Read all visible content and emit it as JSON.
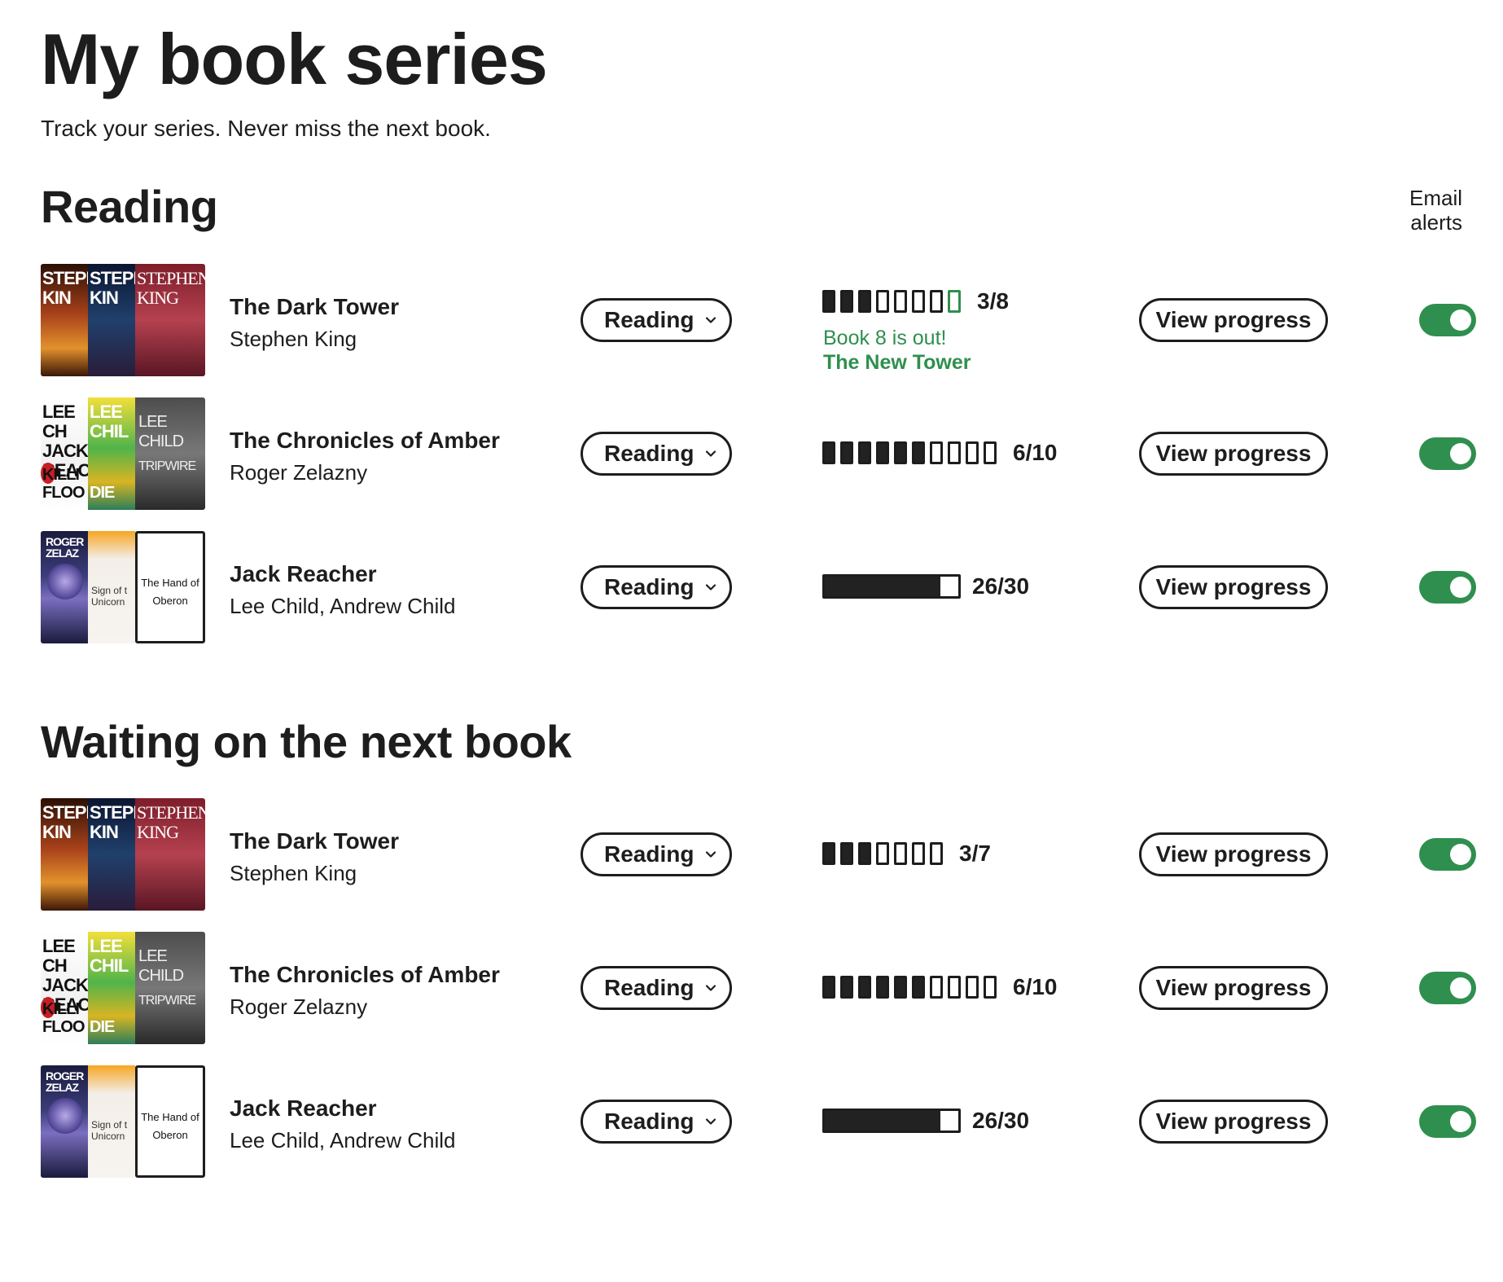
{
  "page": {
    "title": "My book series",
    "subtitle": "Track your series. Never miss the next book."
  },
  "colors": {
    "accent_green": "#2f8f4e",
    "text": "#1d1d1d"
  },
  "sections": [
    {
      "title": "Reading",
      "email_alerts_label": "Email alerts",
      "rows": [
        {
          "name": "The Dark Tower",
          "author": "Stephen King",
          "status": "Reading",
          "progress_text": "3/8",
          "progress_read": 3,
          "progress_total": 8,
          "progress_style": "segments",
          "new_book_segment": 8,
          "new_notice": "Book 8 is out!",
          "new_title": "The New Tower",
          "view_label": "View progress",
          "email_alerts": true,
          "covers": [
            "dark-tower",
            "dark-tower",
            "dark-tower"
          ]
        },
        {
          "name": "The Chronicles of Amber",
          "author": "Roger Zelazny",
          "status": "Reading",
          "progress_text": "6/10",
          "progress_read": 6,
          "progress_total": 10,
          "progress_style": "segments",
          "view_label": "View progress",
          "email_alerts": true,
          "covers": [
            "jack-reacher",
            "jack-reacher",
            "jack-reacher"
          ]
        },
        {
          "name": "Jack Reacher",
          "author": "Lee Child, Andrew Child",
          "status": "Reading",
          "progress_text": "26/30",
          "progress_read": 26,
          "progress_total": 30,
          "progress_style": "bar",
          "view_label": "View progress",
          "email_alerts": true,
          "covers": [
            "amber",
            "amber",
            "amber"
          ]
        }
      ]
    },
    {
      "title": "Waiting on the next book",
      "rows": [
        {
          "name": "The Dark Tower",
          "author": "Stephen King",
          "status": "Reading",
          "progress_text": "3/7",
          "progress_read": 3,
          "progress_total": 7,
          "progress_style": "segments",
          "view_label": "View progress",
          "email_alerts": true,
          "covers": [
            "dark-tower",
            "dark-tower",
            "dark-tower"
          ]
        },
        {
          "name": "The Chronicles of Amber",
          "author": "Roger Zelazny",
          "status": "Reading",
          "progress_text": "6/10",
          "progress_read": 6,
          "progress_total": 10,
          "progress_style": "segments",
          "view_label": "View progress",
          "email_alerts": true,
          "covers": [
            "jack-reacher",
            "jack-reacher",
            "jack-reacher"
          ]
        },
        {
          "name": "Jack Reacher",
          "author": "Lee Child, Andrew Child",
          "status": "Reading",
          "progress_text": "26/30",
          "progress_read": 26,
          "progress_total": 30,
          "progress_style": "bar",
          "view_label": "View progress",
          "email_alerts": true,
          "covers": [
            "amber",
            "amber",
            "amber"
          ]
        }
      ]
    }
  ],
  "cover_texts": {
    "dark_tower": {
      "c1_top": "STEPH KIN",
      "c2_top": "STEPH KIN",
      "c3_top": "STEPHEN KING"
    },
    "jack_reacher": {
      "c1_top": "LEE CH JACK REAC",
      "c1_bottom": "KILLI FLOO",
      "c2_top": "LEE CHIL",
      "c2_bottom": "DIE",
      "c3_top": "LEE CHILD",
      "c3_bottom": "TRIPWIRE"
    },
    "amber": {
      "c1_top": "ROGER ZELAZ",
      "c2_text": "Sign of t Unicorn",
      "c3_text": "The Hand of Oberon"
    }
  }
}
